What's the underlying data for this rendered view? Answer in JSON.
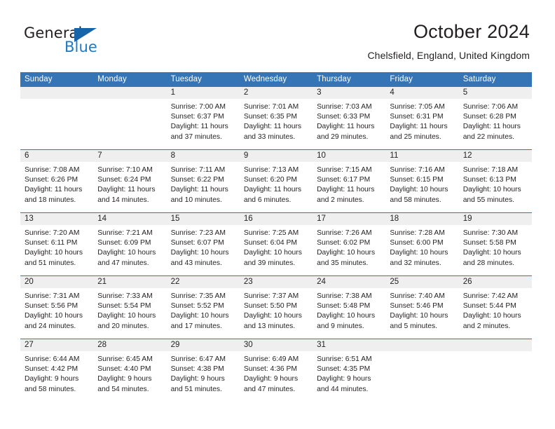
{
  "brand": {
    "word_general": "General",
    "word_blue": "Blue",
    "triangle_color": "#1565a8",
    "blue_color": "#1f7ac4"
  },
  "header": {
    "title": "October 2024",
    "subtitle": "Chelsfield, England, United Kingdom"
  },
  "theme": {
    "header_blue": "#3575b5",
    "daynum_band": "#efefef",
    "text": "#231f20"
  },
  "weekday_headers": [
    "Sunday",
    "Monday",
    "Tuesday",
    "Wednesday",
    "Thursday",
    "Friday",
    "Saturday"
  ],
  "weeks": [
    [
      {
        "day": "",
        "sunrise": "",
        "sunset": "",
        "daylight1": "",
        "daylight2": ""
      },
      {
        "day": "",
        "sunrise": "",
        "sunset": "",
        "daylight1": "",
        "daylight2": ""
      },
      {
        "day": "1",
        "sunrise": "Sunrise: 7:00 AM",
        "sunset": "Sunset: 6:37 PM",
        "daylight1": "Daylight: 11 hours",
        "daylight2": "and 37 minutes."
      },
      {
        "day": "2",
        "sunrise": "Sunrise: 7:01 AM",
        "sunset": "Sunset: 6:35 PM",
        "daylight1": "Daylight: 11 hours",
        "daylight2": "and 33 minutes."
      },
      {
        "day": "3",
        "sunrise": "Sunrise: 7:03 AM",
        "sunset": "Sunset: 6:33 PM",
        "daylight1": "Daylight: 11 hours",
        "daylight2": "and 29 minutes."
      },
      {
        "day": "4",
        "sunrise": "Sunrise: 7:05 AM",
        "sunset": "Sunset: 6:31 PM",
        "daylight1": "Daylight: 11 hours",
        "daylight2": "and 25 minutes."
      },
      {
        "day": "5",
        "sunrise": "Sunrise: 7:06 AM",
        "sunset": "Sunset: 6:28 PM",
        "daylight1": "Daylight: 11 hours",
        "daylight2": "and 22 minutes."
      }
    ],
    [
      {
        "day": "6",
        "sunrise": "Sunrise: 7:08 AM",
        "sunset": "Sunset: 6:26 PM",
        "daylight1": "Daylight: 11 hours",
        "daylight2": "and 18 minutes."
      },
      {
        "day": "7",
        "sunrise": "Sunrise: 7:10 AM",
        "sunset": "Sunset: 6:24 PM",
        "daylight1": "Daylight: 11 hours",
        "daylight2": "and 14 minutes."
      },
      {
        "day": "8",
        "sunrise": "Sunrise: 7:11 AM",
        "sunset": "Sunset: 6:22 PM",
        "daylight1": "Daylight: 11 hours",
        "daylight2": "and 10 minutes."
      },
      {
        "day": "9",
        "sunrise": "Sunrise: 7:13 AM",
        "sunset": "Sunset: 6:20 PM",
        "daylight1": "Daylight: 11 hours",
        "daylight2": "and 6 minutes."
      },
      {
        "day": "10",
        "sunrise": "Sunrise: 7:15 AM",
        "sunset": "Sunset: 6:17 PM",
        "daylight1": "Daylight: 11 hours",
        "daylight2": "and 2 minutes."
      },
      {
        "day": "11",
        "sunrise": "Sunrise: 7:16 AM",
        "sunset": "Sunset: 6:15 PM",
        "daylight1": "Daylight: 10 hours",
        "daylight2": "and 58 minutes."
      },
      {
        "day": "12",
        "sunrise": "Sunrise: 7:18 AM",
        "sunset": "Sunset: 6:13 PM",
        "daylight1": "Daylight: 10 hours",
        "daylight2": "and 55 minutes."
      }
    ],
    [
      {
        "day": "13",
        "sunrise": "Sunrise: 7:20 AM",
        "sunset": "Sunset: 6:11 PM",
        "daylight1": "Daylight: 10 hours",
        "daylight2": "and 51 minutes."
      },
      {
        "day": "14",
        "sunrise": "Sunrise: 7:21 AM",
        "sunset": "Sunset: 6:09 PM",
        "daylight1": "Daylight: 10 hours",
        "daylight2": "and 47 minutes."
      },
      {
        "day": "15",
        "sunrise": "Sunrise: 7:23 AM",
        "sunset": "Sunset: 6:07 PM",
        "daylight1": "Daylight: 10 hours",
        "daylight2": "and 43 minutes."
      },
      {
        "day": "16",
        "sunrise": "Sunrise: 7:25 AM",
        "sunset": "Sunset: 6:04 PM",
        "daylight1": "Daylight: 10 hours",
        "daylight2": "and 39 minutes."
      },
      {
        "day": "17",
        "sunrise": "Sunrise: 7:26 AM",
        "sunset": "Sunset: 6:02 PM",
        "daylight1": "Daylight: 10 hours",
        "daylight2": "and 35 minutes."
      },
      {
        "day": "18",
        "sunrise": "Sunrise: 7:28 AM",
        "sunset": "Sunset: 6:00 PM",
        "daylight1": "Daylight: 10 hours",
        "daylight2": "and 32 minutes."
      },
      {
        "day": "19",
        "sunrise": "Sunrise: 7:30 AM",
        "sunset": "Sunset: 5:58 PM",
        "daylight1": "Daylight: 10 hours",
        "daylight2": "and 28 minutes."
      }
    ],
    [
      {
        "day": "20",
        "sunrise": "Sunrise: 7:31 AM",
        "sunset": "Sunset: 5:56 PM",
        "daylight1": "Daylight: 10 hours",
        "daylight2": "and 24 minutes."
      },
      {
        "day": "21",
        "sunrise": "Sunrise: 7:33 AM",
        "sunset": "Sunset: 5:54 PM",
        "daylight1": "Daylight: 10 hours",
        "daylight2": "and 20 minutes."
      },
      {
        "day": "22",
        "sunrise": "Sunrise: 7:35 AM",
        "sunset": "Sunset: 5:52 PM",
        "daylight1": "Daylight: 10 hours",
        "daylight2": "and 17 minutes."
      },
      {
        "day": "23",
        "sunrise": "Sunrise: 7:37 AM",
        "sunset": "Sunset: 5:50 PM",
        "daylight1": "Daylight: 10 hours",
        "daylight2": "and 13 minutes."
      },
      {
        "day": "24",
        "sunrise": "Sunrise: 7:38 AM",
        "sunset": "Sunset: 5:48 PM",
        "daylight1": "Daylight: 10 hours",
        "daylight2": "and 9 minutes."
      },
      {
        "day": "25",
        "sunrise": "Sunrise: 7:40 AM",
        "sunset": "Sunset: 5:46 PM",
        "daylight1": "Daylight: 10 hours",
        "daylight2": "and 5 minutes."
      },
      {
        "day": "26",
        "sunrise": "Sunrise: 7:42 AM",
        "sunset": "Sunset: 5:44 PM",
        "daylight1": "Daylight: 10 hours",
        "daylight2": "and 2 minutes."
      }
    ],
    [
      {
        "day": "27",
        "sunrise": "Sunrise: 6:44 AM",
        "sunset": "Sunset: 4:42 PM",
        "daylight1": "Daylight: 9 hours",
        "daylight2": "and 58 minutes."
      },
      {
        "day": "28",
        "sunrise": "Sunrise: 6:45 AM",
        "sunset": "Sunset: 4:40 PM",
        "daylight1": "Daylight: 9 hours",
        "daylight2": "and 54 minutes."
      },
      {
        "day": "29",
        "sunrise": "Sunrise: 6:47 AM",
        "sunset": "Sunset: 4:38 PM",
        "daylight1": "Daylight: 9 hours",
        "daylight2": "and 51 minutes."
      },
      {
        "day": "30",
        "sunrise": "Sunrise: 6:49 AM",
        "sunset": "Sunset: 4:36 PM",
        "daylight1": "Daylight: 9 hours",
        "daylight2": "and 47 minutes."
      },
      {
        "day": "31",
        "sunrise": "Sunrise: 6:51 AM",
        "sunset": "Sunset: 4:35 PM",
        "daylight1": "Daylight: 9 hours",
        "daylight2": "and 44 minutes."
      },
      {
        "day": "",
        "sunrise": "",
        "sunset": "",
        "daylight1": "",
        "daylight2": ""
      },
      {
        "day": "",
        "sunrise": "",
        "sunset": "",
        "daylight1": "",
        "daylight2": ""
      }
    ]
  ]
}
